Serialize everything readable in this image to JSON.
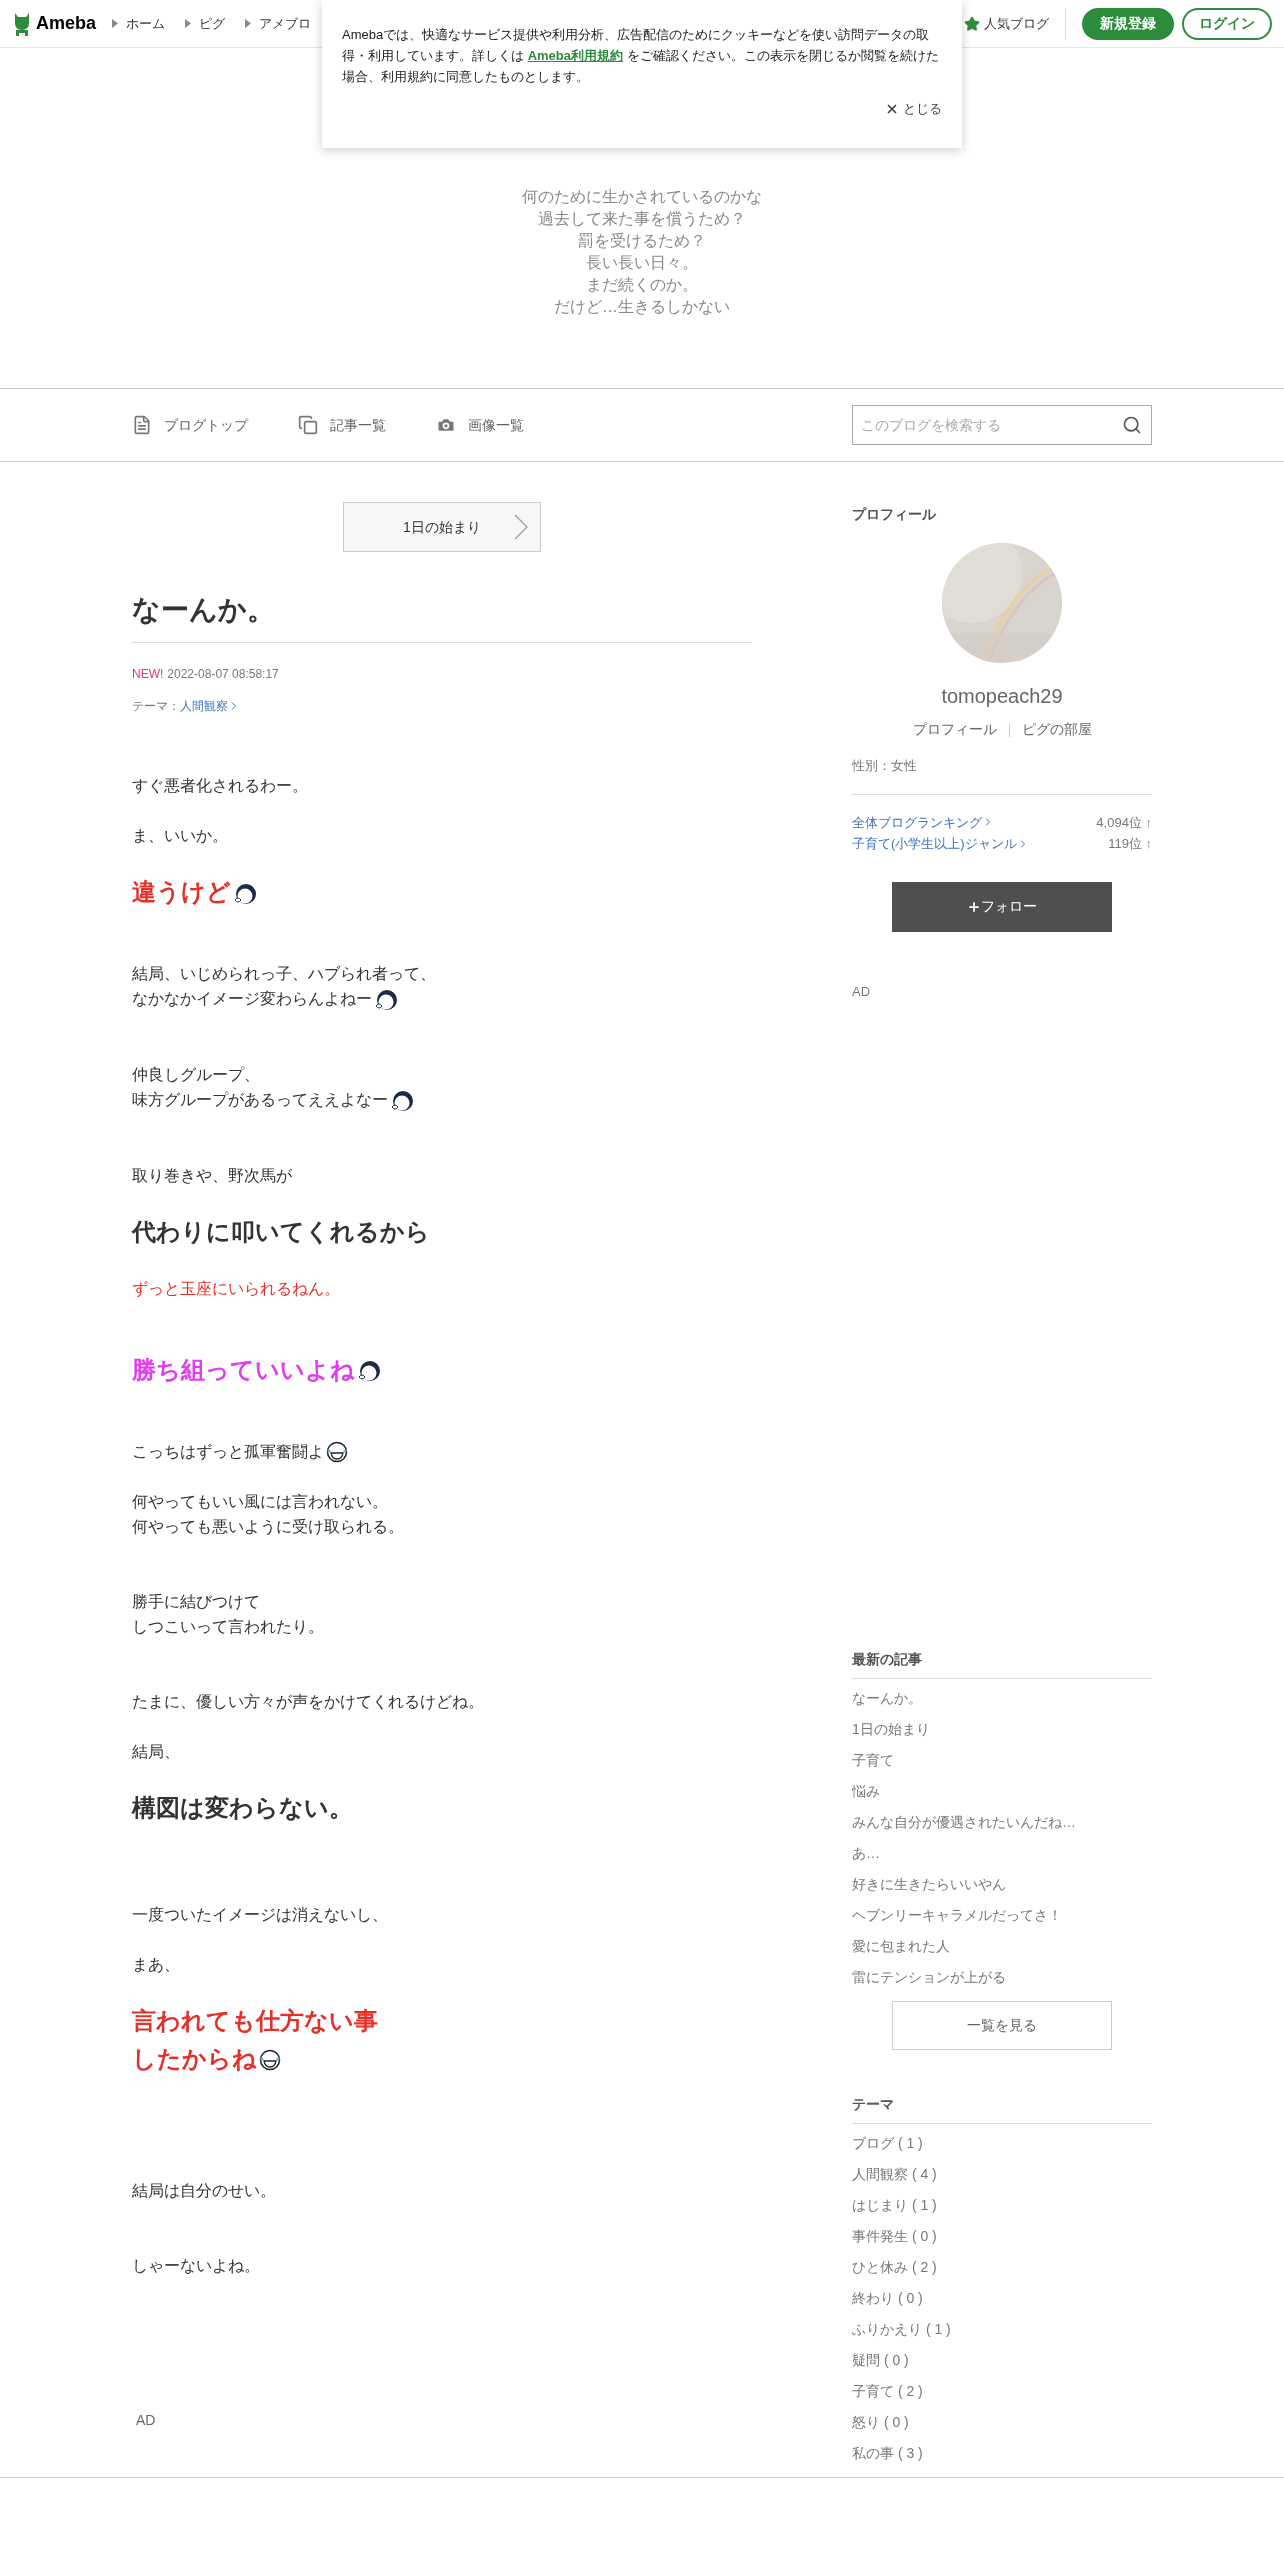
{
  "header": {
    "logo": "Ameba",
    "breadcrumbs": [
      "ホーム",
      "ピグ",
      "アメブロ"
    ],
    "popular": "人気ブログ",
    "signup": "新規登録",
    "login": "ログイン"
  },
  "cookie_notice": {
    "text_before": "Amebaでは、快適なサービス提供や利用分析、広告配信のためにクッキーなどを使い訪問データの取得・利用しています。詳しくは ",
    "link": "Ameba利用規約",
    "text_after": " をご確認ください。この表示を閉じるか閲覧を続けた場合、利用規約に同意したものとします。",
    "close": "とじる"
  },
  "blog": {
    "description": [
      "何のために生かされているのかな",
      "過去して来た事を償うため？",
      "罰を受けるため？",
      "長い長い日々。",
      "まだ続くのか。",
      "だけど…生きるしかない"
    ]
  },
  "nav": {
    "tabs": [
      {
        "label": "ブログトップ",
        "selected": false
      },
      {
        "label": "記事一覧",
        "selected": false
      },
      {
        "label": "画像一覧",
        "selected": false
      }
    ],
    "search_placeholder": "このブログを検索する"
  },
  "article": {
    "next_link": "1日の始まり",
    "title": "なーんか。",
    "new_badge": "NEW!",
    "date": "2022-08-07 08:58:17",
    "theme_label": "テーマ：",
    "theme": "人間観察",
    "blocks": [
      {
        "kind": "text",
        "lines": [
          "すぐ悪者化されるわー。"
        ]
      },
      {
        "kind": "blank"
      },
      {
        "kind": "text",
        "lines": [
          "ま、いいか。"
        ]
      },
      {
        "kind": "blank"
      },
      {
        "kind": "red_large",
        "lines": [
          "違うけど"
        ],
        "icon": {
          "kind": "girl"
        }
      },
      {
        "kind": "blank"
      },
      {
        "kind": "blank"
      },
      {
        "kind": "text",
        "lines": [
          "結局、いじめられっ子、ハブられ者って、",
          "なかなかイメージ変わらんよねー"
        ],
        "icon": {
          "kind": "girl"
        }
      },
      {
        "kind": "blank"
      },
      {
        "kind": "blank"
      },
      {
        "kind": "text",
        "lines": [
          "仲良しグループ、",
          "味方グループがあるってええよなー"
        ],
        "icon": {
          "kind": "girl"
        }
      },
      {
        "kind": "blank"
      },
      {
        "kind": "blank"
      },
      {
        "kind": "text",
        "lines": [
          "取り巻きや、野次馬が"
        ]
      },
      {
        "kind": "blank"
      },
      {
        "kind": "dark_large",
        "lines": [
          "代わりに叩いてくれるから"
        ]
      },
      {
        "kind": "blank"
      },
      {
        "kind": "red_text",
        "lines": [
          "ずっと玉座にいられるねん。"
        ]
      },
      {
        "kind": "blank"
      },
      {
        "kind": "blank"
      },
      {
        "kind": "magenta_large",
        "lines": [
          "勝ち組っていいよね"
        ],
        "icon": {
          "kind": "girl"
        }
      },
      {
        "kind": "blank"
      },
      {
        "kind": "blank"
      },
      {
        "kind": "text",
        "lines": [
          "こっちはずっと孤軍奮闘よ"
        ],
        "icon": {
          "kind": "laugh"
        }
      },
      {
        "kind": "blank"
      },
      {
        "kind": "text",
        "lines": [
          "何やってもいい風には言われない。",
          "何やっても悪いように受け取られる。"
        ]
      },
      {
        "kind": "blank"
      },
      {
        "kind": "blank"
      },
      {
        "kind": "text",
        "lines": [
          "勝手に結びつけて",
          "しつこいって言われたり。"
        ]
      },
      {
        "kind": "blank"
      },
      {
        "kind": "blank"
      },
      {
        "kind": "text",
        "lines": [
          "たまに、優しい方々が声をかけてくれるけどね。"
        ]
      },
      {
        "kind": "blank"
      },
      {
        "kind": "text",
        "lines": [
          "結局、"
        ]
      },
      {
        "kind": "blank"
      },
      {
        "kind": "dark_large",
        "lines": [
          "構図は変わらない。"
        ]
      },
      {
        "kind": "blank"
      },
      {
        "kind": "blank"
      },
      {
        "kind": "blank"
      },
      {
        "kind": "text",
        "lines": [
          "一度ついたイメージは消えないし、"
        ]
      },
      {
        "kind": "blank"
      },
      {
        "kind": "text",
        "lines": [
          "まあ、"
        ]
      },
      {
        "kind": "blank"
      },
      {
        "kind": "red_large",
        "lines": [
          "言われても仕方ない事",
          "したからね"
        ],
        "icon": {
          "kind": "laugh"
        }
      },
      {
        "kind": "blank"
      },
      {
        "kind": "blank"
      },
      {
        "kind": "blank"
      },
      {
        "kind": "blank"
      },
      {
        "kind": "text",
        "lines": [
          "結局は自分のせい。"
        ]
      },
      {
        "kind": "blank"
      },
      {
        "kind": "blank"
      },
      {
        "kind": "text",
        "lines": [
          "しゃーないよね。"
        ]
      }
    ],
    "ad": "AD"
  },
  "sidebar": {
    "profile_heading": "プロフィール",
    "username": "tomopeach29",
    "profile_links": [
      "プロフィール",
      "ピグの部屋"
    ],
    "gender": "性別：女性",
    "rankings": [
      {
        "label": "全体ブログランキング",
        "rank": "4,094位 ↑"
      },
      {
        "label": "子育て(小学生以上)ジャンル",
        "rank": "119位 ↑"
      }
    ],
    "follow": "フォロー",
    "ad": "AD",
    "recent_heading": "最新の記事",
    "recent": [
      "なーんか。",
      "1日の始まり",
      "子育て",
      "悩み",
      "みんな自分が優遇されたいんだね…",
      "あ…",
      "好きに生きたらいいやん",
      "ヘブンリーキャラメルだってさ！",
      "愛に包まれた人",
      "雷にテンションが上がる"
    ],
    "see_all": "一覧を見る",
    "theme_heading": "テーマ",
    "themes": [
      "ブログ ( 1 )",
      "人間観察 ( 4 )",
      "はじまり ( 1 )",
      "事件発生 ( 0 )",
      "ひと休み ( 2 )",
      "終わり ( 0 )",
      "ふりかえり ( 1 )",
      "疑問 ( 0 )",
      "子育て ( 2 )",
      "怒り ( 0 )",
      "私の事 ( 3 )"
    ]
  }
}
